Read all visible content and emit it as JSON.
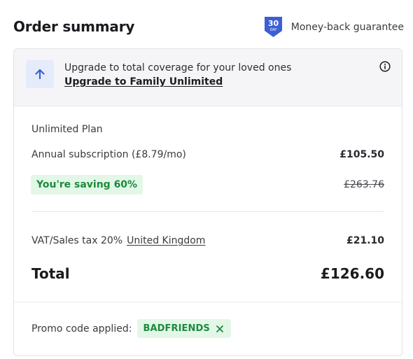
{
  "header": {
    "title": "Order summary",
    "guarantee_badge_top": "30",
    "guarantee_badge_bottom": "DAY",
    "guarantee_text": "Money-back guarantee"
  },
  "upgrade": {
    "icon": "arrow-up-icon",
    "text": "Upgrade to total coverage for your loved ones",
    "link_label": "Upgrade to Family Unlimited",
    "info_icon": "info-icon"
  },
  "plan": {
    "name": "Unlimited Plan",
    "subscription_label": "Annual subscription (£8.79/mo)",
    "subscription_price": "£105.50",
    "saving_label": "You're saving 60%",
    "original_price": "£263.76"
  },
  "tax": {
    "label": "VAT/Sales tax 20%",
    "country": "United Kingdom",
    "amount": "£21.10"
  },
  "total": {
    "label": "Total",
    "amount": "£126.60"
  },
  "promo": {
    "label": "Promo code applied:",
    "code": "BADFRIENDS",
    "remove_icon": "close-icon"
  },
  "colors": {
    "brand_blue": "#3c5fd6",
    "success_green": "#1c8a3b",
    "success_bg": "#e3f7e8",
    "upgrade_bg": "#f5f5f7"
  }
}
